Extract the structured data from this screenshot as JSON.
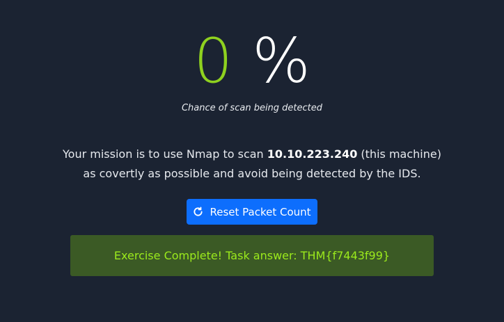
{
  "detection": {
    "value": "0",
    "unit": "%",
    "caption": "Chance of scan being detected"
  },
  "mission": {
    "line1_prefix": "Your mission is to use Nmap to scan ",
    "target_ip": "10.10.223.240",
    "line1_suffix": " (this machine)",
    "line2": "as covertly as possible and avoid being detected by the IDS."
  },
  "reset_button": {
    "label": "Reset Packet Count",
    "icon": "refresh-icon"
  },
  "result": {
    "text": "Exercise Complete! Task answer: THM{f7443f99}"
  },
  "colors": {
    "background": "#1b2332",
    "percent_value": "#8fd11f",
    "button": "#0d6efd",
    "result_bg": "#3b5a25",
    "result_text": "#9bea1c"
  }
}
